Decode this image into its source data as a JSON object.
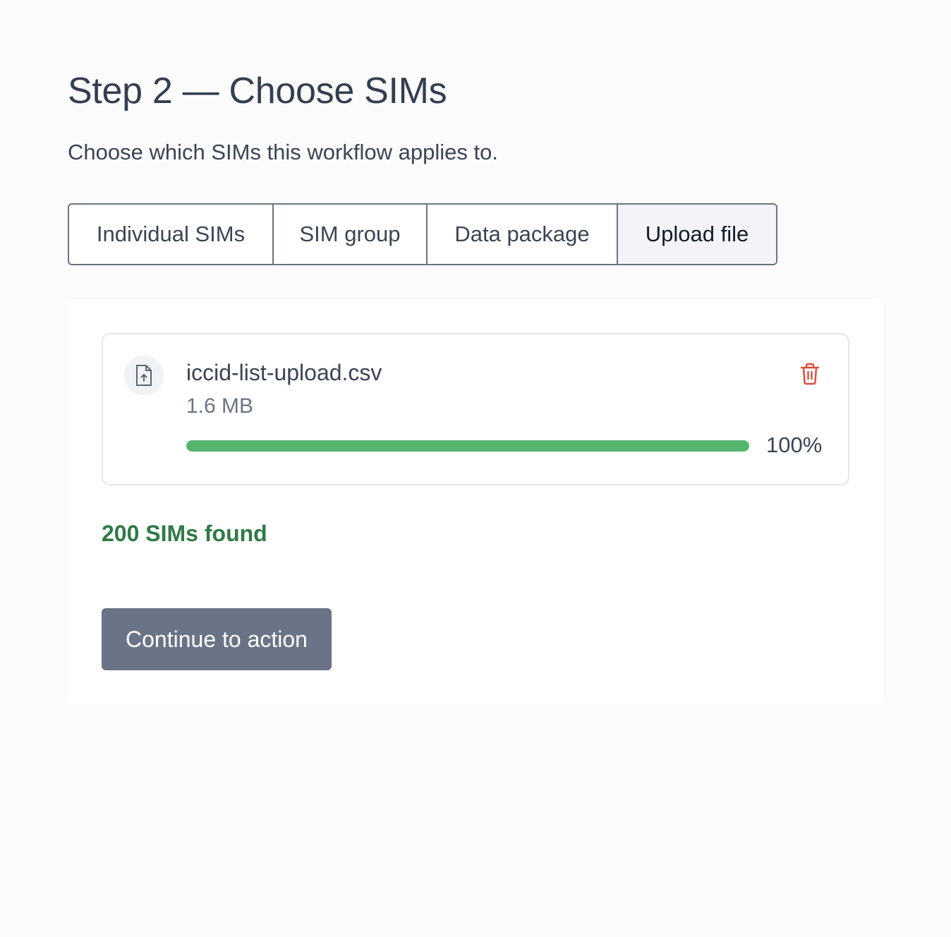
{
  "header": {
    "title": "Step 2 — Choose SIMs",
    "subtitle": "Choose which SIMs this workflow applies to."
  },
  "tabs": [
    {
      "label": "Individual SIMs",
      "active": false
    },
    {
      "label": "SIM group",
      "active": false
    },
    {
      "label": "Data package",
      "active": false
    },
    {
      "label": "Upload file",
      "active": true
    }
  ],
  "upload": {
    "file_icon": "file-upload-icon",
    "file_name": "iccid-list-upload.csv",
    "file_size": "1.6 MB",
    "progress_percent": 100,
    "progress_label": "100%",
    "delete_icon": "trash-icon",
    "progress_color": "#55b56f",
    "delete_color": "#e04a3b"
  },
  "result": {
    "sims_found": "200 SIMs found",
    "color": "#2f7a47"
  },
  "actions": {
    "continue_label": "Continue to action"
  }
}
